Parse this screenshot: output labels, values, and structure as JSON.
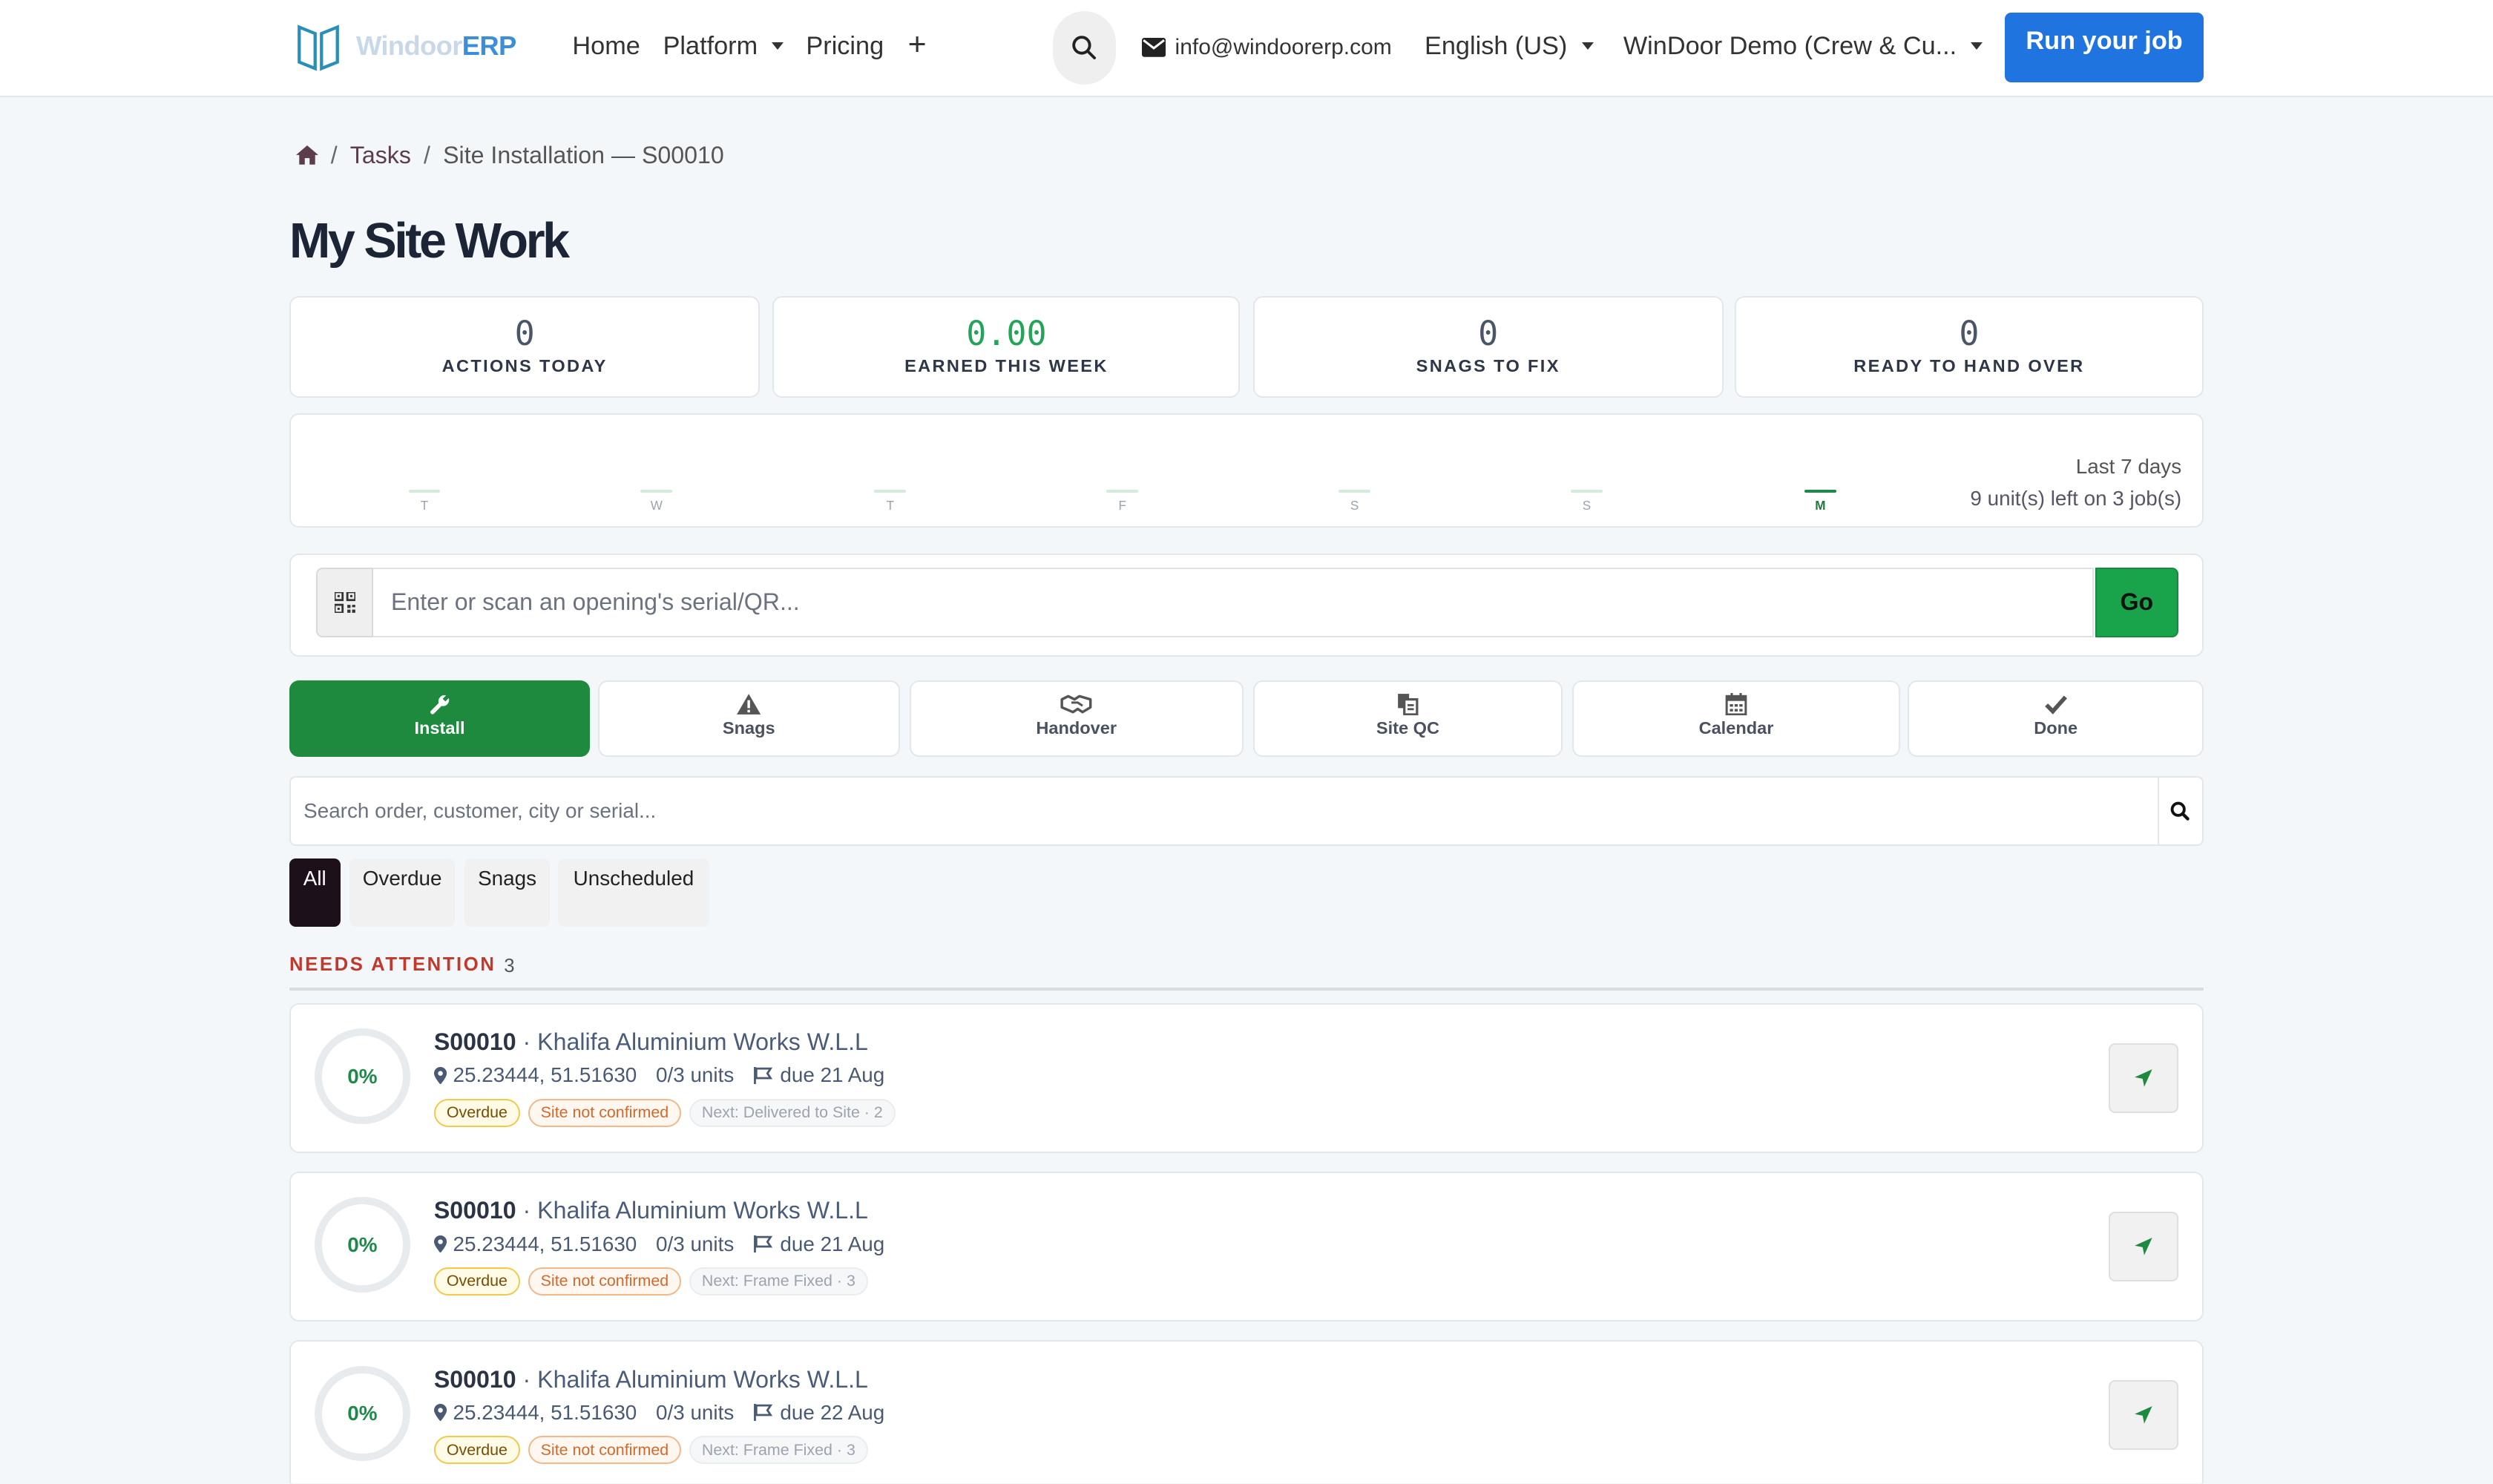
{
  "brand": {
    "logo_left": "Windoor",
    "logo_right": "ERP"
  },
  "nav": {
    "home": "Home",
    "platform": "Platform",
    "pricing": "Pricing",
    "add": "+",
    "email": "info@windoorerp.com",
    "language": "English (US)",
    "company": "WinDoor Demo (Crew & Cu...",
    "cta": "Run your job"
  },
  "breadcrumb": {
    "tasks": "Tasks",
    "current": "Site Installation — S00010"
  },
  "page_title": "My Site Work",
  "stats": [
    {
      "value": "0",
      "label": "ACTIONS TODAY"
    },
    {
      "value": "0.00",
      "label": "EARNED THIS WEEK"
    },
    {
      "value": "0",
      "label": "SNAGS TO FIX"
    },
    {
      "value": "0",
      "label": "READY TO HAND OVER"
    }
  ],
  "week": {
    "days": [
      "T",
      "W",
      "T",
      "F",
      "S",
      "S",
      "M"
    ],
    "active_day": "M",
    "range_label": "Last 7 days",
    "summary": "9 unit(s) left on 3 job(s)"
  },
  "scan": {
    "placeholder": "Enter or scan an opening's serial/QR...",
    "go": "Go"
  },
  "tabs": [
    {
      "label": "Install",
      "icon": "wrench-icon",
      "active": true
    },
    {
      "label": "Snags",
      "icon": "warning-icon"
    },
    {
      "label": "Handover",
      "icon": "handshake-icon"
    },
    {
      "label": "Site QC",
      "icon": "copy-icon"
    },
    {
      "label": "Calendar",
      "icon": "calendar-icon"
    },
    {
      "label": "Done",
      "icon": "check-icon"
    }
  ],
  "search": {
    "placeholder": "Search order, customer, city or serial..."
  },
  "filters": [
    {
      "label": "All",
      "active": true
    },
    {
      "label": "Overdue"
    },
    {
      "label": "Snags"
    },
    {
      "label": "Unscheduled"
    }
  ],
  "section": {
    "title": "NEEDS ATTENTION",
    "count": "3"
  },
  "jobs": [
    {
      "progress": "0%",
      "order": "S00010",
      "customer": "Khalifa Aluminium Works W.L.L",
      "coords": "25.23444, 51.51630",
      "units": "0/3 units",
      "due": "due 21 Aug",
      "tag_overdue": "Overdue",
      "tag_site": "Site not confirmed",
      "next": "Next: Delivered to Site · 2"
    },
    {
      "progress": "0%",
      "order": "S00010",
      "customer": "Khalifa Aluminium Works W.L.L",
      "coords": "25.23444, 51.51630",
      "units": "0/3 units",
      "due": "due 21 Aug",
      "tag_overdue": "Overdue",
      "tag_site": "Site not confirmed",
      "next": "Next: Frame Fixed · 3"
    },
    {
      "progress": "0%",
      "order": "S00010",
      "customer": "Khalifa Aluminium Works W.L.L",
      "coords": "25.23444, 51.51630",
      "units": "0/3 units",
      "due": "due 22 Aug",
      "tag_overdue": "Overdue",
      "tag_site": "Site not confirmed",
      "next": "Next: Frame Fixed · 3"
    }
  ],
  "colors": {
    "primary": "#1f74e0",
    "green": "#1d8a3e",
    "danger": "#c0392b"
  }
}
